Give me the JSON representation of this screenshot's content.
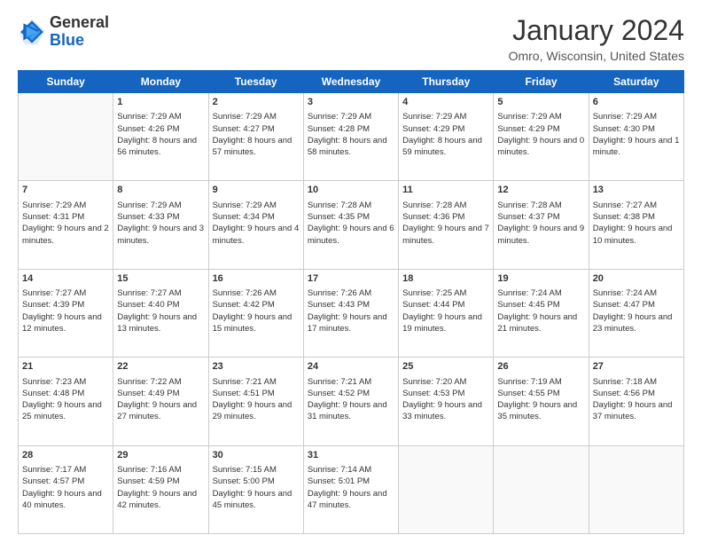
{
  "header": {
    "logo_line1": "General",
    "logo_line2": "Blue",
    "title": "January 2024",
    "subtitle": "Omro, Wisconsin, United States"
  },
  "weekdays": [
    "Sunday",
    "Monday",
    "Tuesday",
    "Wednesday",
    "Thursday",
    "Friday",
    "Saturday"
  ],
  "weeks": [
    [
      {
        "day": "",
        "sunrise": "",
        "sunset": "",
        "daylight": "",
        "empty": true
      },
      {
        "day": "1",
        "sunrise": "Sunrise: 7:29 AM",
        "sunset": "Sunset: 4:26 PM",
        "daylight": "Daylight: 8 hours and 56 minutes."
      },
      {
        "day": "2",
        "sunrise": "Sunrise: 7:29 AM",
        "sunset": "Sunset: 4:27 PM",
        "daylight": "Daylight: 8 hours and 57 minutes."
      },
      {
        "day": "3",
        "sunrise": "Sunrise: 7:29 AM",
        "sunset": "Sunset: 4:28 PM",
        "daylight": "Daylight: 8 hours and 58 minutes."
      },
      {
        "day": "4",
        "sunrise": "Sunrise: 7:29 AM",
        "sunset": "Sunset: 4:29 PM",
        "daylight": "Daylight: 8 hours and 59 minutes."
      },
      {
        "day": "5",
        "sunrise": "Sunrise: 7:29 AM",
        "sunset": "Sunset: 4:29 PM",
        "daylight": "Daylight: 9 hours and 0 minutes."
      },
      {
        "day": "6",
        "sunrise": "Sunrise: 7:29 AM",
        "sunset": "Sunset: 4:30 PM",
        "daylight": "Daylight: 9 hours and 1 minute."
      }
    ],
    [
      {
        "day": "7",
        "sunrise": "Sunrise: 7:29 AM",
        "sunset": "Sunset: 4:31 PM",
        "daylight": "Daylight: 9 hours and 2 minutes."
      },
      {
        "day": "8",
        "sunrise": "Sunrise: 7:29 AM",
        "sunset": "Sunset: 4:33 PM",
        "daylight": "Daylight: 9 hours and 3 minutes."
      },
      {
        "day": "9",
        "sunrise": "Sunrise: 7:29 AM",
        "sunset": "Sunset: 4:34 PM",
        "daylight": "Daylight: 9 hours and 4 minutes."
      },
      {
        "day": "10",
        "sunrise": "Sunrise: 7:28 AM",
        "sunset": "Sunset: 4:35 PM",
        "daylight": "Daylight: 9 hours and 6 minutes."
      },
      {
        "day": "11",
        "sunrise": "Sunrise: 7:28 AM",
        "sunset": "Sunset: 4:36 PM",
        "daylight": "Daylight: 9 hours and 7 minutes."
      },
      {
        "day": "12",
        "sunrise": "Sunrise: 7:28 AM",
        "sunset": "Sunset: 4:37 PM",
        "daylight": "Daylight: 9 hours and 9 minutes."
      },
      {
        "day": "13",
        "sunrise": "Sunrise: 7:27 AM",
        "sunset": "Sunset: 4:38 PM",
        "daylight": "Daylight: 9 hours and 10 minutes."
      }
    ],
    [
      {
        "day": "14",
        "sunrise": "Sunrise: 7:27 AM",
        "sunset": "Sunset: 4:39 PM",
        "daylight": "Daylight: 9 hours and 12 minutes."
      },
      {
        "day": "15",
        "sunrise": "Sunrise: 7:27 AM",
        "sunset": "Sunset: 4:40 PM",
        "daylight": "Daylight: 9 hours and 13 minutes."
      },
      {
        "day": "16",
        "sunrise": "Sunrise: 7:26 AM",
        "sunset": "Sunset: 4:42 PM",
        "daylight": "Daylight: 9 hours and 15 minutes."
      },
      {
        "day": "17",
        "sunrise": "Sunrise: 7:26 AM",
        "sunset": "Sunset: 4:43 PM",
        "daylight": "Daylight: 9 hours and 17 minutes."
      },
      {
        "day": "18",
        "sunrise": "Sunrise: 7:25 AM",
        "sunset": "Sunset: 4:44 PM",
        "daylight": "Daylight: 9 hours and 19 minutes."
      },
      {
        "day": "19",
        "sunrise": "Sunrise: 7:24 AM",
        "sunset": "Sunset: 4:45 PM",
        "daylight": "Daylight: 9 hours and 21 minutes."
      },
      {
        "day": "20",
        "sunrise": "Sunrise: 7:24 AM",
        "sunset": "Sunset: 4:47 PM",
        "daylight": "Daylight: 9 hours and 23 minutes."
      }
    ],
    [
      {
        "day": "21",
        "sunrise": "Sunrise: 7:23 AM",
        "sunset": "Sunset: 4:48 PM",
        "daylight": "Daylight: 9 hours and 25 minutes."
      },
      {
        "day": "22",
        "sunrise": "Sunrise: 7:22 AM",
        "sunset": "Sunset: 4:49 PM",
        "daylight": "Daylight: 9 hours and 27 minutes."
      },
      {
        "day": "23",
        "sunrise": "Sunrise: 7:21 AM",
        "sunset": "Sunset: 4:51 PM",
        "daylight": "Daylight: 9 hours and 29 minutes."
      },
      {
        "day": "24",
        "sunrise": "Sunrise: 7:21 AM",
        "sunset": "Sunset: 4:52 PM",
        "daylight": "Daylight: 9 hours and 31 minutes."
      },
      {
        "day": "25",
        "sunrise": "Sunrise: 7:20 AM",
        "sunset": "Sunset: 4:53 PM",
        "daylight": "Daylight: 9 hours and 33 minutes."
      },
      {
        "day": "26",
        "sunrise": "Sunrise: 7:19 AM",
        "sunset": "Sunset: 4:55 PM",
        "daylight": "Daylight: 9 hours and 35 minutes."
      },
      {
        "day": "27",
        "sunrise": "Sunrise: 7:18 AM",
        "sunset": "Sunset: 4:56 PM",
        "daylight": "Daylight: 9 hours and 37 minutes."
      }
    ],
    [
      {
        "day": "28",
        "sunrise": "Sunrise: 7:17 AM",
        "sunset": "Sunset: 4:57 PM",
        "daylight": "Daylight: 9 hours and 40 minutes."
      },
      {
        "day": "29",
        "sunrise": "Sunrise: 7:16 AM",
        "sunset": "Sunset: 4:59 PM",
        "daylight": "Daylight: 9 hours and 42 minutes."
      },
      {
        "day": "30",
        "sunrise": "Sunrise: 7:15 AM",
        "sunset": "Sunset: 5:00 PM",
        "daylight": "Daylight: 9 hours and 45 minutes."
      },
      {
        "day": "31",
        "sunrise": "Sunrise: 7:14 AM",
        "sunset": "Sunset: 5:01 PM",
        "daylight": "Daylight: 9 hours and 47 minutes."
      },
      {
        "day": "",
        "sunrise": "",
        "sunset": "",
        "daylight": "",
        "empty": true
      },
      {
        "day": "",
        "sunrise": "",
        "sunset": "",
        "daylight": "",
        "empty": true
      },
      {
        "day": "",
        "sunrise": "",
        "sunset": "",
        "daylight": "",
        "empty": true
      }
    ]
  ]
}
